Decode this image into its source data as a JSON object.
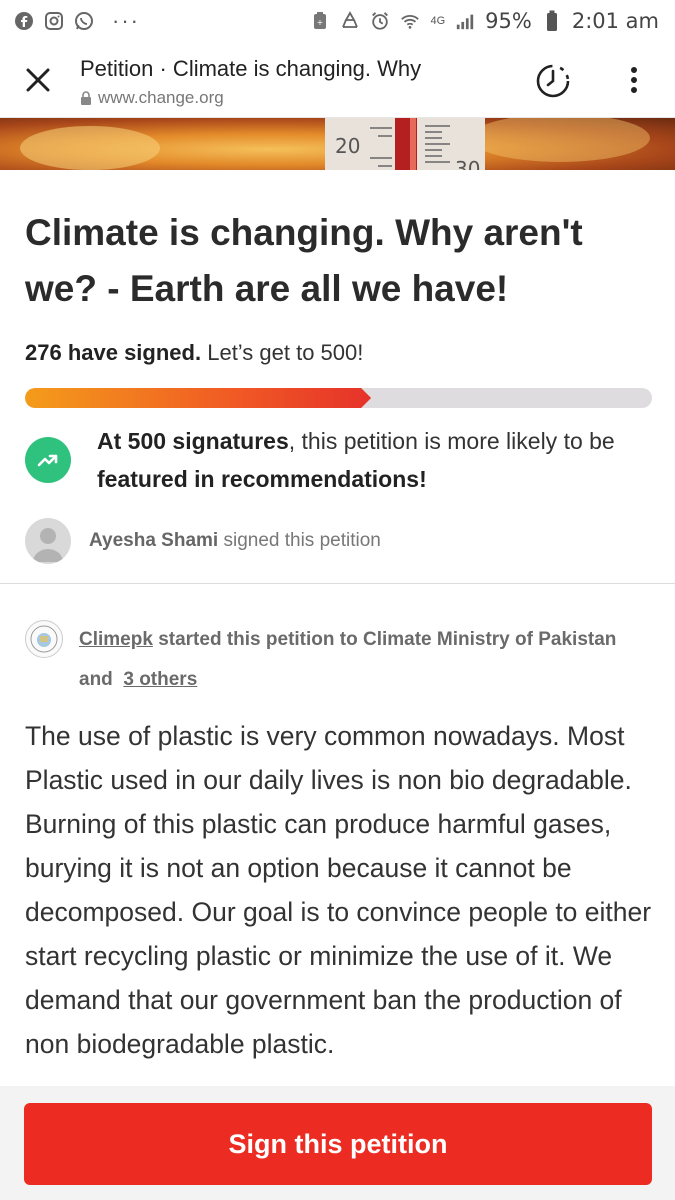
{
  "status_bar": {
    "battery": "95%",
    "network": "4G",
    "time": "2:01 am",
    "left_icons": [
      "facebook-icon",
      "instagram-icon",
      "whatsapp-icon"
    ],
    "more": "···"
  },
  "browser": {
    "tab_title": "Petition · Climate is changing. Why",
    "url": "www.change.org"
  },
  "petition": {
    "title": "Climate is changing. Why aren't we? - Earth are all we have!",
    "signed_count": "276 have signed.",
    "goal_text": "Let’s get to 500!",
    "progress_fraction": 0.552,
    "milestone_strong1": "At 500 signatures",
    "milestone_mid": ", this petition is more likely to be ",
    "milestone_strong2": "featured in recommendations!",
    "recent_signer_name": "Ayesha Shami",
    "recent_signer_action": "signed this petition",
    "starter_name": "Climepk",
    "starter_action": "started this petition to Climate Ministry of Pakistan and",
    "starter_others": "3 others",
    "body": "The use of plastic is very common nowadays. Most Plastic used in our daily lives is non bio degradable. Burning of this plastic can produce harmful gases, burying it is not an option because it cannot be decomposed. Our goal is to convince people to either start recycling plastic or minimize the use of it. We demand that our government ban the production of non biodegradable plastic.",
    "sign_button": "Sign this petition"
  },
  "colors": {
    "accent_red": "#ec2c22",
    "progress_start": "#f49c1b",
    "progress_end": "#e6322a",
    "trend_green": "#2ec27e"
  }
}
